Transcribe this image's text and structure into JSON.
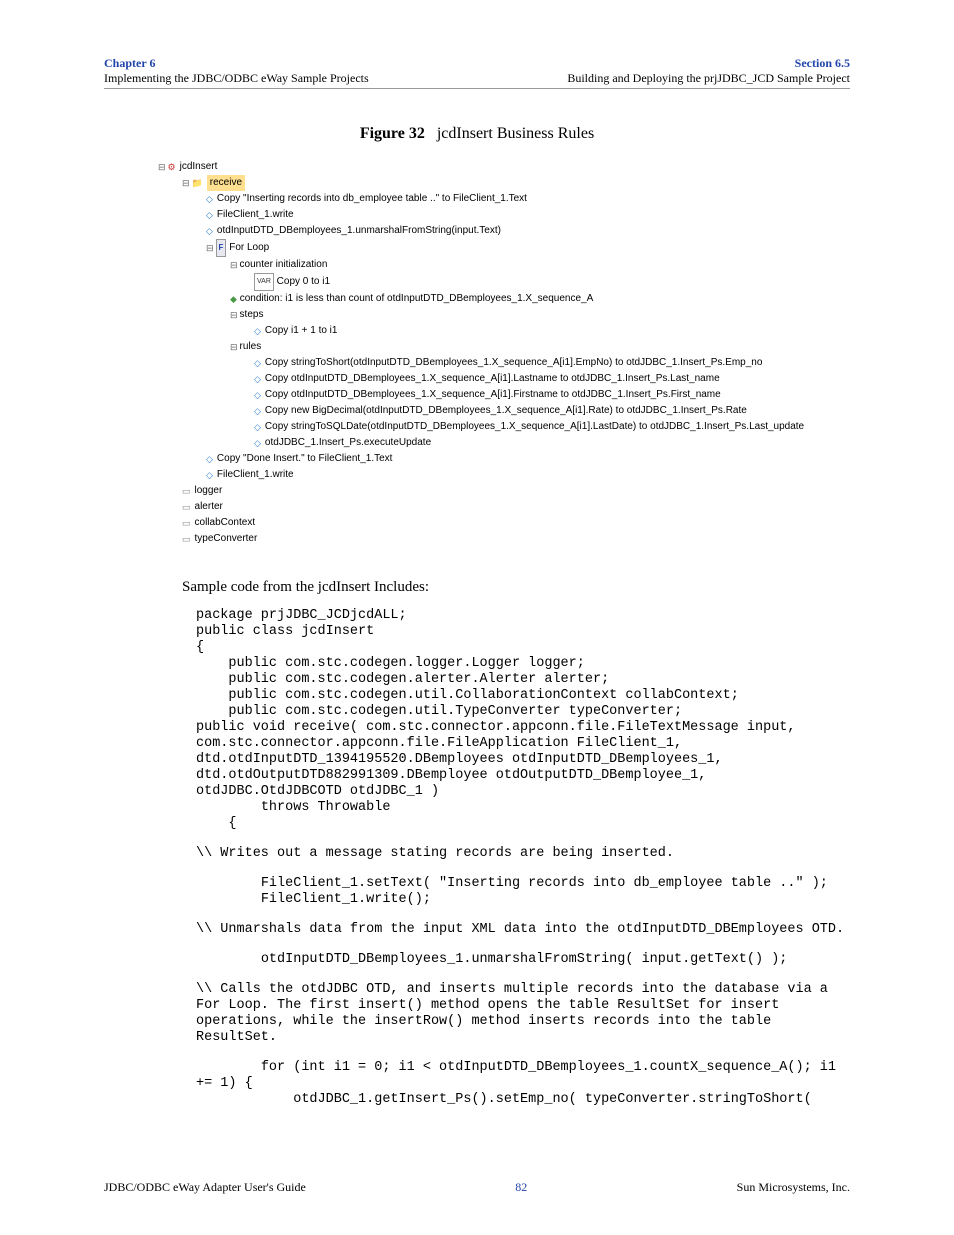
{
  "header": {
    "chapter": "Chapter 6",
    "chapterSub": "Implementing the JDBC/ODBC eWay Sample Projects",
    "section": "Section 6.5",
    "sectionSub": "Building and Deploying the prjJDBC_JCD Sample Project"
  },
  "figure": {
    "label": "Figure 32",
    "title": "jcdInsert Business Rules"
  },
  "tree": {
    "root": "jcdInsert",
    "receive": "receive",
    "r1": "Copy \"Inserting records into db_employee table ..\" to FileClient_1.Text",
    "r2": "FileClient_1.write",
    "r3": "otdInputDTD_DBemployees_1.unmarshalFromString(input.Text)",
    "forLoop": "For Loop",
    "counterInit": "counter initialization",
    "copy0": "Copy 0 to i1",
    "condition": "condition: i1 is less than count of otdInputDTD_DBemployees_1.X_sequence_A",
    "steps": "steps",
    "copyPlus1": "Copy i1 + 1 to i1",
    "rules": "rules",
    "rule1": "Copy stringToShort(otdInputDTD_DBemployees_1.X_sequence_A[i1].EmpNo) to otdJDBC_1.Insert_Ps.Emp_no",
    "rule2": "Copy otdInputDTD_DBemployees_1.X_sequence_A[i1].Lastname to otdJDBC_1.Insert_Ps.Last_name",
    "rule3": "Copy otdInputDTD_DBemployees_1.X_sequence_A[i1].Firstname to otdJDBC_1.Insert_Ps.First_name",
    "rule4": "Copy new BigDecimal(otdInputDTD_DBemployees_1.X_sequence_A[i1].Rate) to otdJDBC_1.Insert_Ps.Rate",
    "rule5": "Copy stringToSQLDate(otdInputDTD_DBemployees_1.X_sequence_A[i1].LastDate) to otdJDBC_1.Insert_Ps.Last_update",
    "rule6": "otdJDBC_1.Insert_Ps.executeUpdate",
    "done1": "Copy \"Done Insert.\" to FileClient_1.Text",
    "done2": "FileClient_1.write",
    "logger": "logger",
    "alerter": "alerter",
    "collab": "collabContext",
    "typeConv": "typeConverter"
  },
  "bodyText": "Sample code from the jcdInsert Includes:",
  "code1": "package prjJDBC_JCDjcdALL;\npublic class jcdInsert\n{\n    public com.stc.codegen.logger.Logger logger;\n    public com.stc.codegen.alerter.Alerter alerter;\n    public com.stc.codegen.util.CollaborationContext collabContext;\n    public com.stc.codegen.util.TypeConverter typeConverter;\npublic void receive( com.stc.connector.appconn.file.FileTextMessage input, com.stc.connector.appconn.file.FileApplication FileClient_1, dtd.otdInputDTD_1394195520.DBemployees otdInputDTD_DBemployees_1, dtd.otdOutputDTD882991309.DBemployee otdOutputDTD_DBemployee_1, otdJDBC.OtdJDBCOTD otdJDBC_1 )\n        throws Throwable\n    {",
  "comment1": "\\\\ Writes out a message stating records are being inserted.",
  "code2": "        FileClient_1.setText( \"Inserting records into db_employee table ..\" );\n        FileClient_1.write();",
  "comment2": "\\\\ Unmarshals data from the input XML data into the otdInputDTD_DBEmployees OTD.",
  "code3": "        otdInputDTD_DBemployees_1.unmarshalFromString( input.getText() );",
  "comment3": "\\\\ Calls the otdJDBC OTD, and inserts multiple records into the database via a For Loop. The first insert() method opens the table ResultSet for insert operations, while the insertRow() method inserts records into the table ResultSet.",
  "code4": "        for (int i1 = 0; i1 < otdInputDTD_DBemployees_1.countX_sequence_A(); i1 += 1) {\n            otdJDBC_1.getInsert_Ps().setEmp_no( typeConverter.stringToShort(",
  "footer": {
    "left": "JDBC/ODBC eWay Adapter User's Guide",
    "page": "82",
    "right": "Sun Microsystems, Inc."
  }
}
